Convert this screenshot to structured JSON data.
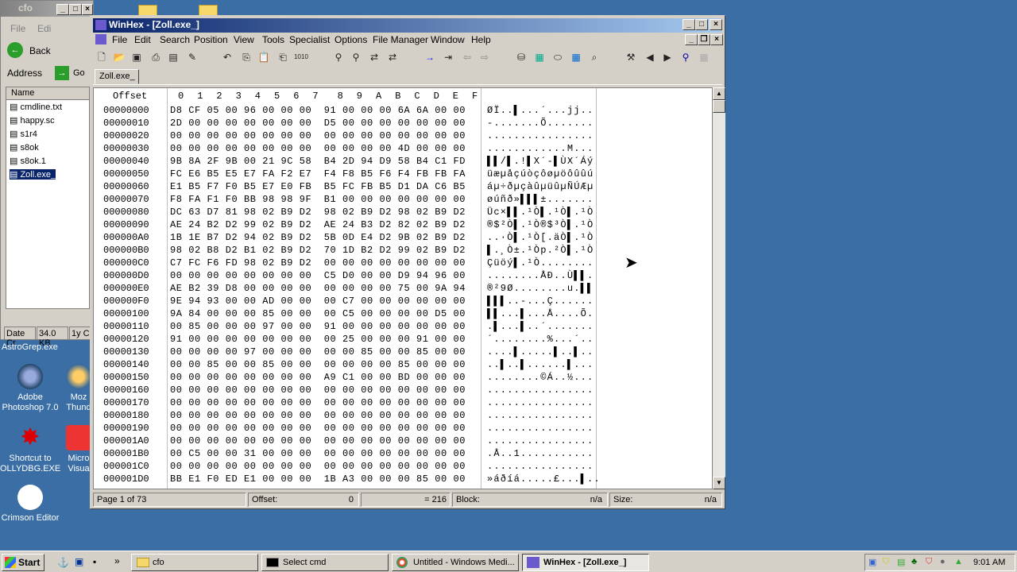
{
  "explorer": {
    "title": "cfo",
    "menu": [
      "File",
      "Edi"
    ],
    "back_label": "Back",
    "address_label": "Address",
    "go_label": "Go",
    "column_name": "Name",
    "files": [
      "cmdline.txt",
      "happy.sc",
      "s1r4",
      "s8ok",
      "s8ok.1",
      "Zoll.exe_"
    ],
    "status": [
      "Date Cr",
      "34.0 KB",
      "1y C"
    ],
    "below_label": "AstroGrep.exe"
  },
  "desktop": {
    "icons": [
      {
        "label": "Adobe Photoshop 7.0"
      },
      {
        "label": "Moz Thund"
      },
      {
        "label": "Shortcut to OLLYDBG.EXE"
      },
      {
        "label": "Micro Visua"
      },
      {
        "label": "Crimson Editor"
      }
    ]
  },
  "winhex": {
    "title": "WinHex - [Zoll.exe_]",
    "menu": [
      "File",
      "Edit",
      "Search",
      "Position",
      "View",
      "Tools",
      "Specialist",
      "Options",
      "File Manager",
      "Window",
      "Help"
    ],
    "tab": "Zoll.exe_",
    "header_offset": "Offset",
    "header_cols": [
      "0",
      "1",
      "2",
      "3",
      "4",
      "5",
      "6",
      "7",
      "8",
      "9",
      "A",
      "B",
      "C",
      "D",
      "E",
      "F"
    ],
    "rows": [
      {
        "off": "00000000",
        "hex": "D8 CF 05 00 96 00 00 00  91 00 00 00 6A 6A 00 00",
        "asc": "ØÏ..▌...´...jj.."
      },
      {
        "off": "00000010",
        "hex": "2D 00 00 00 00 00 00 00  D5 00 00 00 00 00 00 00",
        "asc": "-.......Õ......."
      },
      {
        "off": "00000020",
        "hex": "00 00 00 00 00 00 00 00  00 00 00 00 00 00 00 00",
        "asc": "................"
      },
      {
        "off": "00000030",
        "hex": "00 00 00 00 00 00 00 00  00 00 00 00 4D 00 00 00",
        "asc": "............M..."
      },
      {
        "off": "00000040",
        "hex": "9B 8A 2F 9B 00 21 9C 58  B4 2D 94 D9 58 B4 C1 FD",
        "asc": "▌▌/▌.!▌X´-▌ÙX´Áý"
      },
      {
        "off": "00000050",
        "hex": "FC E6 B5 E5 E7 FA F2 E7  F4 F8 B5 F6 F4 FB FB FA",
        "asc": "üæµåçúòçôøµöôûûú"
      },
      {
        "off": "00000060",
        "hex": "E1 B5 F7 F0 B5 E7 E0 FB  B5 FC FB B5 D1 DA C6 B5",
        "asc": "áµ÷ðµçàûµüûµÑÚÆµ"
      },
      {
        "off": "00000070",
        "hex": "F8 FA F1 F0 BB 98 98 9F  B1 00 00 00 00 00 00 00",
        "asc": "øúñð»▌▌▌±......."
      },
      {
        "off": "00000080",
        "hex": "DC 63 D7 81 98 02 B9 D2  98 02 B9 D2 98 02 B9 D2",
        "asc": "Üc×▌▌.¹Ò▌.¹Ò▌.¹Ò"
      },
      {
        "off": "00000090",
        "hex": "AE 24 B2 D2 99 02 B9 D2  AE 24 B3 D2 82 02 B9 D2",
        "asc": "®$²Ò▌.¹Ò®$³Ò▌.¹Ò"
      },
      {
        "off": "000000A0",
        "hex": "1B 1E B7 D2 94 02 B9 D2  5B 0D E4 D2 9B 02 B9 D2",
        "asc": "..·Ò▌.¹Ò[.äÒ▌.¹Ò"
      },
      {
        "off": "000000B0",
        "hex": "98 02 B8 D2 B1 02 B9 D2  70 1D B2 D2 99 02 B9 D2",
        "asc": "▌.¸Ò±.¹Òp.²Ò▌.¹Ò"
      },
      {
        "off": "000000C0",
        "hex": "C7 FC F6 FD 98 02 B9 D2  00 00 00 00 00 00 00 00",
        "asc": "Çüöý▌.¹Ò........"
      },
      {
        "off": "000000D0",
        "hex": "00 00 00 00 00 00 00 00  C5 D0 00 00 D9 94 96 00",
        "asc": "........ÅÐ..Ù▌▌."
      },
      {
        "off": "000000E0",
        "hex": "AE B2 39 D8 00 00 00 00  00 00 00 00 75 00 9A 94",
        "asc": "®²9Ø........u.▌▌"
      },
      {
        "off": "000000F0",
        "hex": "9E 94 93 00 00 AD 00 00  00 C7 00 00 00 00 00 00",
        "asc": "▌▌▌..-...Ç......"
      },
      {
        "off": "00000100",
        "hex": "9A 84 00 00 00 85 00 00  00 C5 00 00 00 00 D5 00",
        "asc": "▌▌...▌...Å....Õ."
      },
      {
        "off": "00000110",
        "hex": "00 85 00 00 00 97 00 00  91 00 00 00 00 00 00 00",
        "asc": ".▌...▌..´......."
      },
      {
        "off": "00000120",
        "hex": "91 00 00 00 00 00 00 00  00 25 00 00 00 91 00 00",
        "asc": "´........%...´.."
      },
      {
        "off": "00000130",
        "hex": "00 00 00 00 97 00 00 00  00 00 85 00 00 85 00 00",
        "asc": "....▌.....▌..▌.."
      },
      {
        "off": "00000140",
        "hex": "00 00 85 00 00 85 00 00  00 00 00 00 85 00 00 00",
        "asc": "..▌..▌......▌..."
      },
      {
        "off": "00000150",
        "hex": "00 00 00 00 00 00 00 00  A9 C1 00 00 BD 00 00 00",
        "asc": "........©Á..½..."
      },
      {
        "off": "00000160",
        "hex": "00 00 00 00 00 00 00 00  00 00 00 00 00 00 00 00",
        "asc": "................"
      },
      {
        "off": "00000170",
        "hex": "00 00 00 00 00 00 00 00  00 00 00 00 00 00 00 00",
        "asc": "................"
      },
      {
        "off": "00000180",
        "hex": "00 00 00 00 00 00 00 00  00 00 00 00 00 00 00 00",
        "asc": "................"
      },
      {
        "off": "00000190",
        "hex": "00 00 00 00 00 00 00 00  00 00 00 00 00 00 00 00",
        "asc": "................"
      },
      {
        "off": "000001A0",
        "hex": "00 00 00 00 00 00 00 00  00 00 00 00 00 00 00 00",
        "asc": "................"
      },
      {
        "off": "000001B0",
        "hex": "00 C5 00 00 31 00 00 00  00 00 00 00 00 00 00 00",
        "asc": ".Å..1..........."
      },
      {
        "off": "000001C0",
        "hex": "00 00 00 00 00 00 00 00  00 00 00 00 00 00 00 00",
        "asc": "................"
      },
      {
        "off": "000001D0",
        "hex": "BB E1 F0 ED E1 00 00 00  1B A3 00 00 00 85 00 00",
        "asc": "»áðíá.....£...▌.."
      }
    ],
    "status": {
      "page": "Page 1 of 73",
      "offset_label": "Offset:",
      "offset_value": "0",
      "value_label": "= 216",
      "block_label": "Block:",
      "block_value": "n/a",
      "size_label": "Size:",
      "size_value": "n/a"
    }
  },
  "taskbar": {
    "start": "Start",
    "tasks": [
      {
        "label": "cfo",
        "active": false
      },
      {
        "label": "Select cmd",
        "active": false
      },
      {
        "label": "Untitled - Windows Medi...",
        "active": false
      },
      {
        "label": "WinHex - [Zoll.exe_]",
        "active": true
      }
    ],
    "clock": "9:01 AM"
  }
}
